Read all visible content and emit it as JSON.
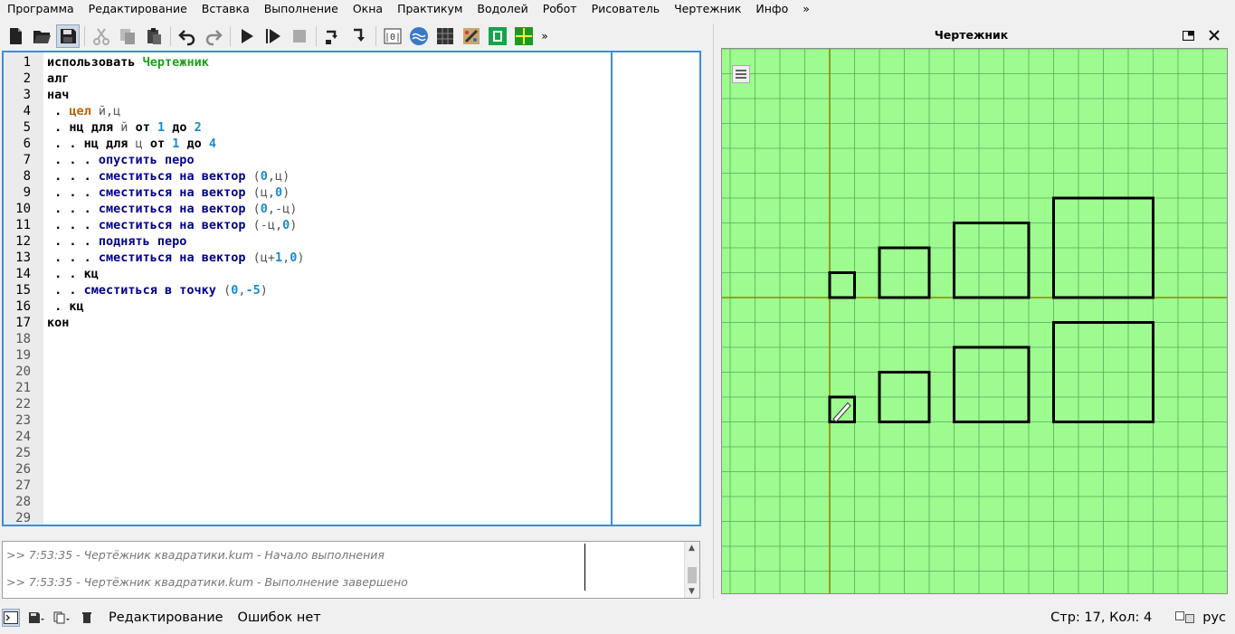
{
  "menu": [
    "Программа",
    "Редактирование",
    "Вставка",
    "Выполнение",
    "Окна",
    "Практикум",
    "Водолей",
    "Робот",
    "Рисователь",
    "Чертежник",
    "Инфо",
    "»"
  ],
  "toolbar_more": "»",
  "editor": {
    "lines": [
      {
        "n": "1",
        "t": [
          {
            "c": "kw",
            "s": "использовать "
          },
          {
            "c": "kw-green",
            "s": "Чертежник"
          }
        ]
      },
      {
        "n": "2",
        "t": [
          {
            "c": "kw",
            "s": "алг"
          }
        ]
      },
      {
        "n": "3",
        "t": [
          {
            "c": "kw",
            "s": "нач"
          }
        ]
      },
      {
        "n": "4",
        "t": [
          {
            "c": "dot",
            "s": " . "
          },
          {
            "c": "kw-orange",
            "s": "цел "
          },
          {
            "c": "var",
            "s": "й,ц"
          }
        ]
      },
      {
        "n": "5",
        "t": [
          {
            "c": "dot",
            "s": " . "
          },
          {
            "c": "kw",
            "s": "нц для "
          },
          {
            "c": "var",
            "s": "й "
          },
          {
            "c": "kw",
            "s": "от "
          },
          {
            "c": "num",
            "s": "1 "
          },
          {
            "c": "kw",
            "s": "до "
          },
          {
            "c": "num",
            "s": "2"
          }
        ]
      },
      {
        "n": "6",
        "t": [
          {
            "c": "dot",
            "s": " . . "
          },
          {
            "c": "kw",
            "s": "нц для "
          },
          {
            "c": "var",
            "s": "ц "
          },
          {
            "c": "kw",
            "s": "от "
          },
          {
            "c": "num",
            "s": "1 "
          },
          {
            "c": "kw",
            "s": "до "
          },
          {
            "c": "num",
            "s": "4"
          }
        ]
      },
      {
        "n": "7",
        "t": [
          {
            "c": "dot",
            "s": " . . . "
          },
          {
            "c": "kw-blue",
            "s": "опустить перо"
          }
        ]
      },
      {
        "n": "8",
        "t": [
          {
            "c": "dot",
            "s": " . . . "
          },
          {
            "c": "kw-blue",
            "s": "сместиться на вектор "
          },
          {
            "c": "var",
            "s": "("
          },
          {
            "c": "num",
            "s": "0"
          },
          {
            "c": "var",
            "s": ",ц)"
          }
        ]
      },
      {
        "n": "9",
        "t": [
          {
            "c": "dot",
            "s": " . . . "
          },
          {
            "c": "kw-blue",
            "s": "сместиться на вектор "
          },
          {
            "c": "var",
            "s": "(ц,"
          },
          {
            "c": "num",
            "s": "0"
          },
          {
            "c": "var",
            "s": ")"
          }
        ]
      },
      {
        "n": "10",
        "t": [
          {
            "c": "dot",
            "s": " . . . "
          },
          {
            "c": "kw-blue",
            "s": "сместиться на вектор "
          },
          {
            "c": "var",
            "s": "("
          },
          {
            "c": "num",
            "s": "0"
          },
          {
            "c": "var",
            "s": ",-ц)"
          }
        ]
      },
      {
        "n": "11",
        "t": [
          {
            "c": "dot",
            "s": " . . . "
          },
          {
            "c": "kw-blue",
            "s": "сместиться на вектор "
          },
          {
            "c": "var",
            "s": "(-ц,"
          },
          {
            "c": "num",
            "s": "0"
          },
          {
            "c": "var",
            "s": ")"
          }
        ]
      },
      {
        "n": "12",
        "t": [
          {
            "c": "dot",
            "s": " . . . "
          },
          {
            "c": "kw-blue",
            "s": "поднять перо"
          }
        ]
      },
      {
        "n": "13",
        "t": [
          {
            "c": "dot",
            "s": " . . . "
          },
          {
            "c": "kw-blue",
            "s": "сместиться на вектор "
          },
          {
            "c": "var",
            "s": "(ц+"
          },
          {
            "c": "num",
            "s": "1"
          },
          {
            "c": "var",
            "s": ","
          },
          {
            "c": "num",
            "s": "0"
          },
          {
            "c": "var",
            "s": ")"
          }
        ]
      },
      {
        "n": "14",
        "t": [
          {
            "c": "dot",
            "s": " . . "
          },
          {
            "c": "kw",
            "s": "кц"
          }
        ]
      },
      {
        "n": "15",
        "t": [
          {
            "c": "dot",
            "s": " . . "
          },
          {
            "c": "kw-blue",
            "s": "сместиться в точку "
          },
          {
            "c": "var",
            "s": "("
          },
          {
            "c": "num",
            "s": "0"
          },
          {
            "c": "var",
            "s": ","
          },
          {
            "c": "num",
            "s": "-5"
          },
          {
            "c": "var",
            "s": ")"
          }
        ]
      },
      {
        "n": "16",
        "t": [
          {
            "c": "dot",
            "s": " . "
          },
          {
            "c": "kw",
            "s": "кц"
          }
        ]
      },
      {
        "n": "17",
        "t": [
          {
            "c": "kw",
            "s": "кон"
          }
        ]
      },
      {
        "n": "18",
        "t": []
      },
      {
        "n": "19",
        "t": []
      },
      {
        "n": "20",
        "t": []
      },
      {
        "n": "21",
        "t": []
      },
      {
        "n": "22",
        "t": []
      },
      {
        "n": "23",
        "t": []
      },
      {
        "n": "24",
        "t": []
      },
      {
        "n": "25",
        "t": []
      },
      {
        "n": "26",
        "t": []
      },
      {
        "n": "27",
        "t": []
      },
      {
        "n": "28",
        "t": []
      },
      {
        "n": "29",
        "t": []
      }
    ]
  },
  "console": {
    "lines": [
      ">>   7:53:35 - Чертёжник квадратики.kum - Начало выполнения",
      ">>   7:53:35 - Чертёжник квадратики.kum - Выполнение завершено"
    ]
  },
  "status": {
    "mode": "Редактирование",
    "errors": "Ошибок нет",
    "position": "Стр: 17, Кол: 4",
    "language": "рус"
  },
  "drawer": {
    "title": "Чертежник",
    "grid_color": "#9dfb8f",
    "axis_color": "#8a8a00"
  }
}
